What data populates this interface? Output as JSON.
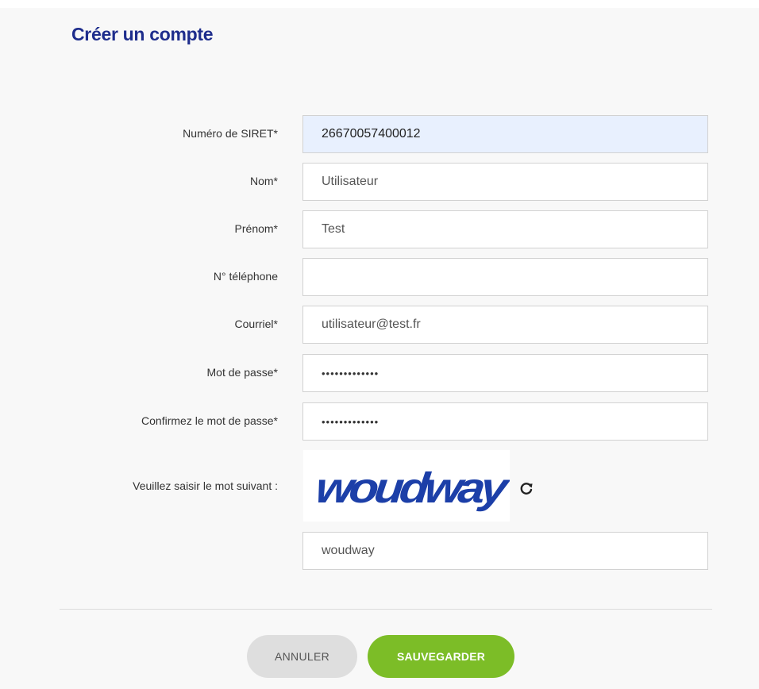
{
  "form": {
    "title": "Créer un compte",
    "fields": [
      {
        "label": "Numéro de SIRET*",
        "value": "26670057400012"
      },
      {
        "label": "Nom*",
        "value": "Utilisateur"
      },
      {
        "label": "Prénom*",
        "value": "Test"
      },
      {
        "label": "N° téléphone",
        "value": ""
      },
      {
        "label": "Courriel*",
        "value": "utilisateur@test.fr"
      },
      {
        "label": "Mot de passe*",
        "value": "•••••••••••••"
      },
      {
        "label": "Confirmez le mot de passe*",
        "value": "•••••••••••••"
      }
    ],
    "captcha": {
      "label": "Veuillez saisir le mot suivant :",
      "image_word": "woudway",
      "value": "woudway",
      "refresh_icon": "refresh-icon"
    },
    "buttons": {
      "cancel": "ANNULER",
      "save": "SAUVEGARDER"
    }
  },
  "colors": {
    "title": "#1e2d8c",
    "captcha_text": "#1c3fa8",
    "save_button": "#7cbd27",
    "cancel_button": "#dedede",
    "autofill_bg": "#e8f0fe"
  }
}
